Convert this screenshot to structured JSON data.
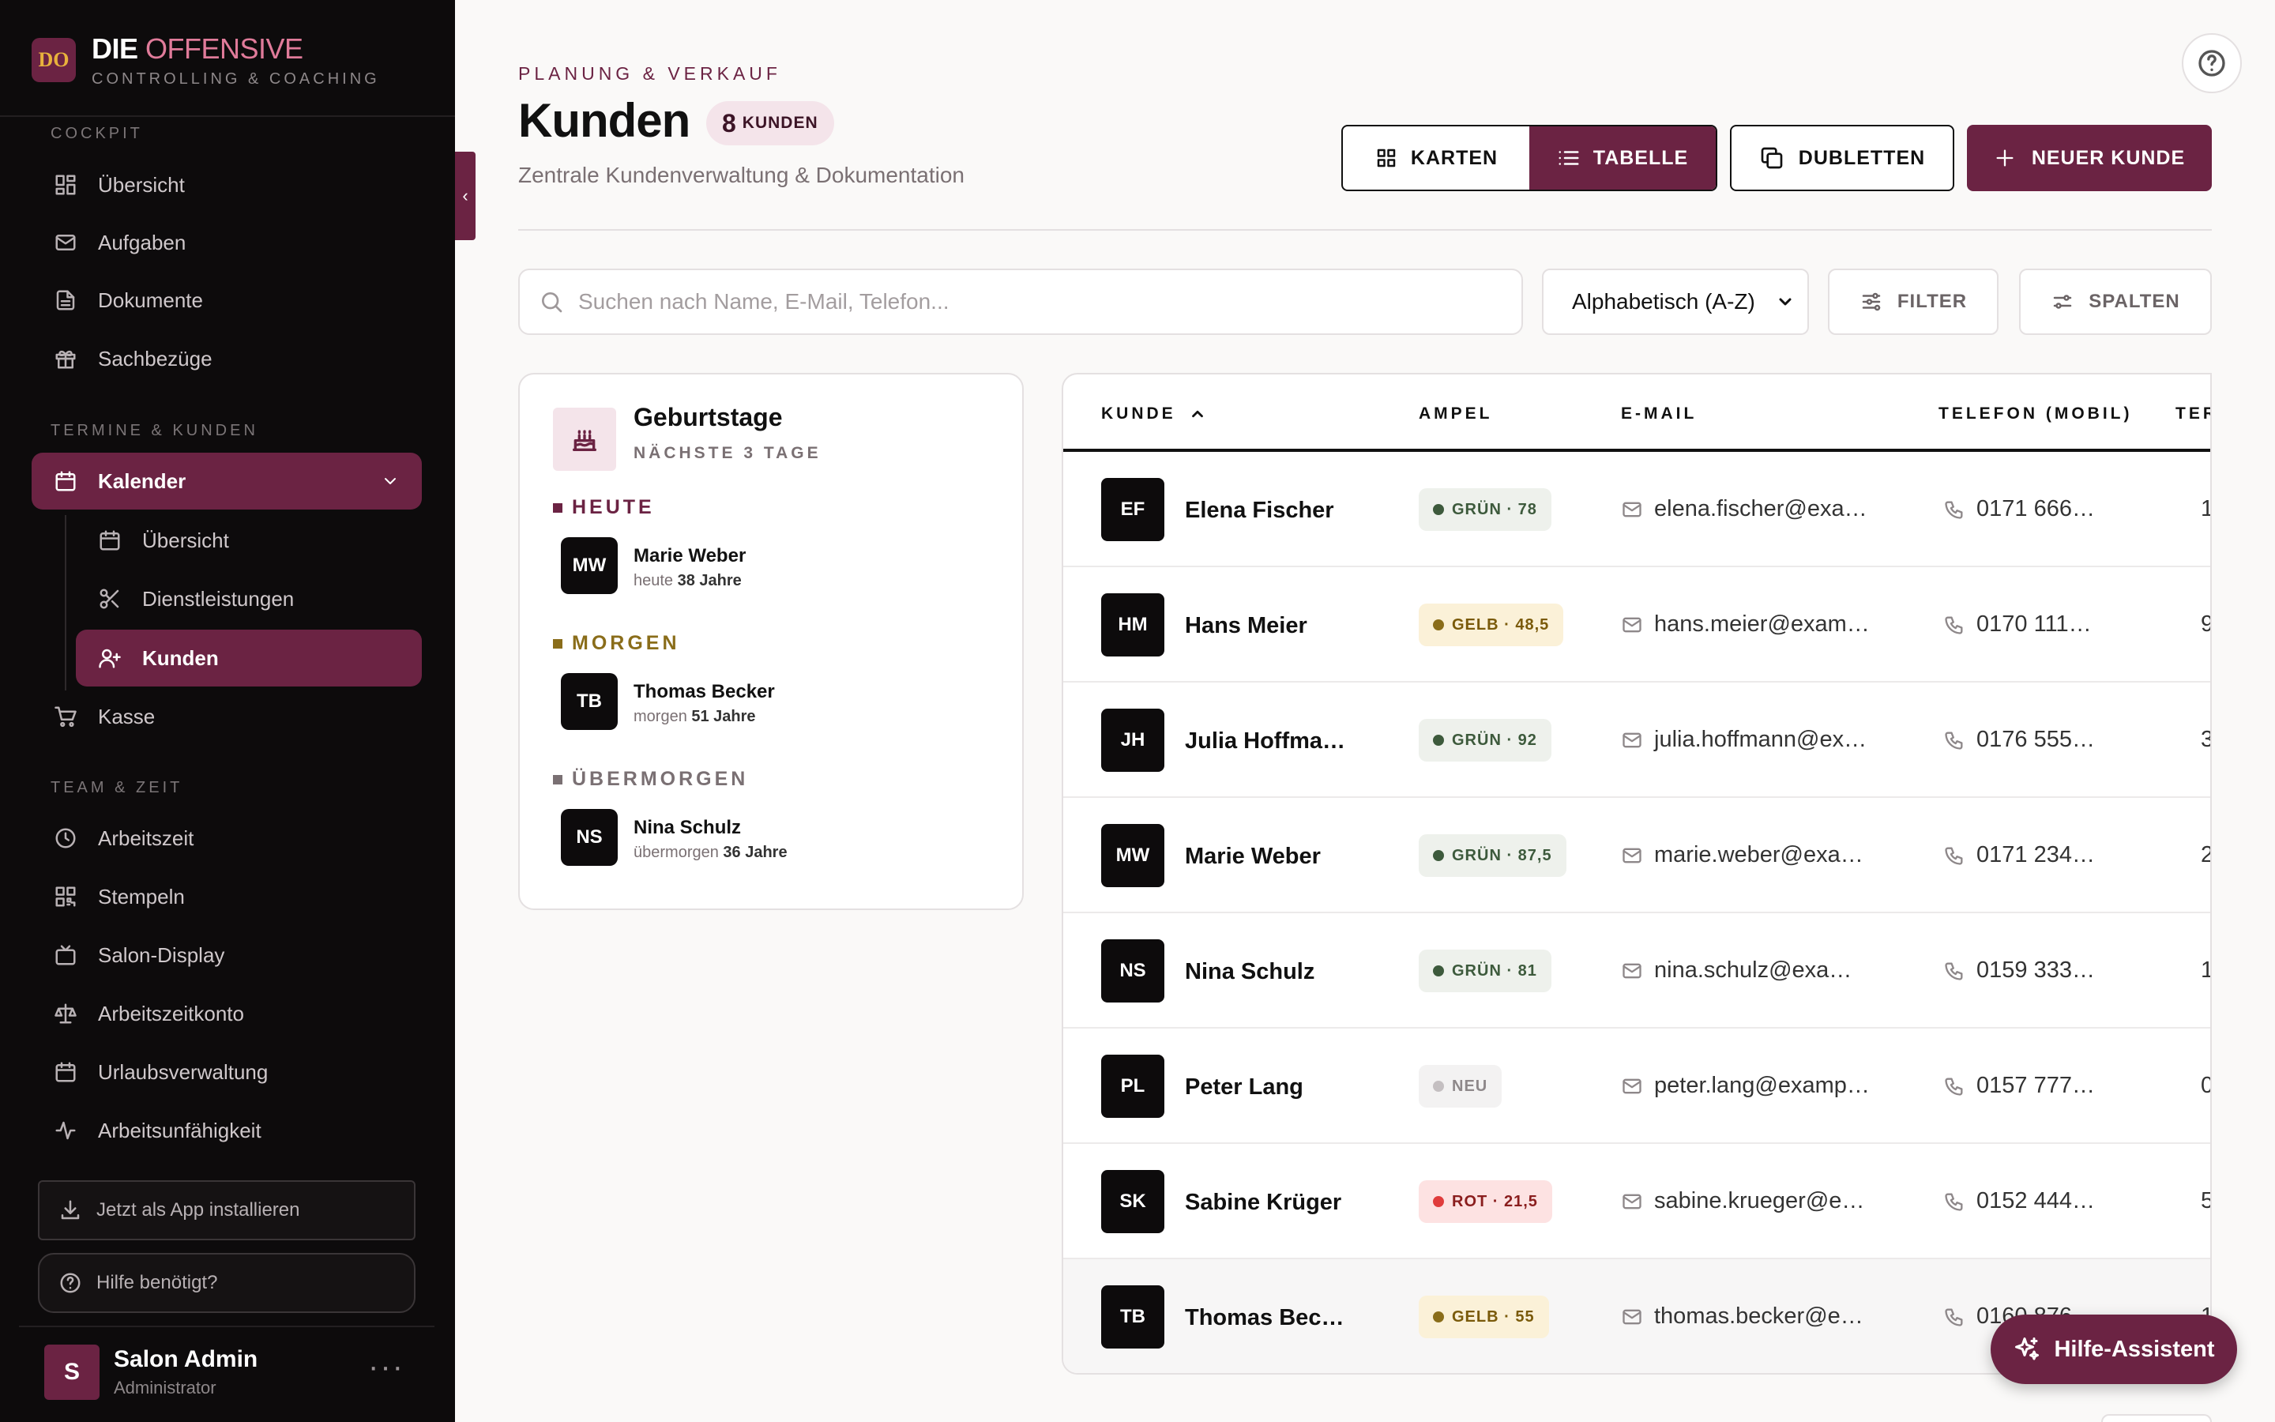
{
  "brand": {
    "logo_text": "DO",
    "name_main": "DIE",
    "name_accent": "OFFENSIVE",
    "subtitle": "CONTROLLING & COACHING",
    "accent_color": "#6b2343"
  },
  "sidebar": {
    "sections": {
      "cockpit": "COCKPIT",
      "termine": "TERMINE & KUNDEN",
      "team": "TEAM & ZEIT"
    },
    "cockpit_items": [
      {
        "label": "Übersicht",
        "icon": "dashboard-icon"
      },
      {
        "label": "Aufgaben",
        "icon": "mail-icon"
      },
      {
        "label": "Dokumente",
        "icon": "document-icon"
      },
      {
        "label": "Sachbezüge",
        "icon": "gift-icon"
      }
    ],
    "kalender": {
      "label": "Kalender",
      "icon": "calendar-icon"
    },
    "kalender_sub": [
      {
        "label": "Übersicht",
        "icon": "calendar-icon"
      },
      {
        "label": "Dienstleistungen",
        "icon": "scissors-icon"
      },
      {
        "label": "Kunden",
        "icon": "user-plus-icon"
      }
    ],
    "kasse": {
      "label": "Kasse",
      "icon": "cart-icon"
    },
    "team_items": [
      {
        "label": "Arbeitszeit",
        "icon": "clock-icon"
      },
      {
        "label": "Stempeln",
        "icon": "qr-icon"
      },
      {
        "label": "Salon-Display",
        "icon": "tv-icon"
      },
      {
        "label": "Arbeitszeitkonto",
        "icon": "scale-icon"
      },
      {
        "label": "Urlaubsverwaltung",
        "icon": "calendar-icon"
      },
      {
        "label": "Arbeitsunfähigkeit",
        "icon": "activity-icon"
      }
    ],
    "install_label": "Jetzt als App installieren",
    "help_label": "Hilfe benötigt?",
    "user": {
      "initial": "S",
      "name": "Salon Admin",
      "role": "Administrator"
    }
  },
  "header": {
    "kicker": "PLANUNG & VERKAUF",
    "title": "Kunden",
    "count": "8",
    "count_label": "KUNDEN",
    "subtitle": "Zentrale Kundenverwaltung & Dokumentation"
  },
  "toolbar": {
    "karten": "KARTEN",
    "tabelle": "TABELLE",
    "dubletten": "DUBLETTEN",
    "neuer_kunde": "NEUER KUNDE",
    "search_placeholder": "Suchen nach Name, E-Mail, Telefon...",
    "sort_value": "Alphabetisch (A-Z)",
    "filter": "FILTER",
    "spalten": "SPALTEN"
  },
  "birthdays": {
    "title": "Geburtstage",
    "subtitle": "NÄCHSTE 3 TAGE",
    "groups": [
      {
        "label": "HEUTE",
        "color": "#6b2343",
        "initials": "MW",
        "name": "Marie Weber",
        "when": "heute",
        "age": "38 Jahre"
      },
      {
        "label": "MORGEN",
        "color": "#8a6d1a",
        "initials": "TB",
        "name": "Thomas Becker",
        "when": "morgen",
        "age": "51 Jahre"
      },
      {
        "label": "ÜBERMORGEN",
        "color": "#7a7073",
        "initials": "NS",
        "name": "Nina Schulz",
        "when": "übermorgen",
        "age": "36 Jahre"
      }
    ]
  },
  "table": {
    "columns": {
      "kunde": "KUNDE",
      "ampel": "AMPEL",
      "email": "E-MAIL",
      "telefon": "TELEFON (MOBIL)",
      "termine": "TER"
    },
    "rows": [
      {
        "initials": "EF",
        "name": "Elena Fischer",
        "ampel": "GRÜN · 78",
        "status": "green",
        "email": "elena.fischer@exa…",
        "phone": "0171 666…",
        "termine": "1"
      },
      {
        "initials": "HM",
        "name": "Hans Meier",
        "ampel": "GELB · 48,5",
        "status": "yellow",
        "email": "hans.meier@exam…",
        "phone": "0170 111…",
        "termine": "9"
      },
      {
        "initials": "JH",
        "name": "Julia Hoffma…",
        "ampel": "GRÜN · 92",
        "status": "green",
        "email": "julia.hoffmann@ex…",
        "phone": "0176 555…",
        "termine": "3"
      },
      {
        "initials": "MW",
        "name": "Marie Weber",
        "ampel": "GRÜN · 87,5",
        "status": "green",
        "email": "marie.weber@exa…",
        "phone": "0171 234…",
        "termine": "2"
      },
      {
        "initials": "NS",
        "name": "Nina Schulz",
        "ampel": "GRÜN · 81",
        "status": "green",
        "email": "nina.schulz@exa…",
        "phone": "0159 333…",
        "termine": "1"
      },
      {
        "initials": "PL",
        "name": "Peter Lang",
        "ampel": "NEU",
        "status": "new",
        "email": "peter.lang@examp…",
        "phone": "0157 777…",
        "termine": "0"
      },
      {
        "initials": "SK",
        "name": "Sabine Krüger",
        "ampel": "ROT · 21,5",
        "status": "red",
        "email": "sabine.krueger@e…",
        "phone": "0152 444…",
        "termine": "5"
      },
      {
        "initials": "TB",
        "name": "Thomas Bec…",
        "ampel": "GELB · 55",
        "status": "yellow",
        "email": "thomas.becker@e…",
        "phone": "0160 876…",
        "termine": "1"
      }
    ]
  },
  "status_colors": {
    "green": {
      "bg": "#eef1ec",
      "fg": "#3d5a3c",
      "dot": "#3d5a3c"
    },
    "yellow": {
      "bg": "#fbf1d8",
      "fg": "#7a5a0a",
      "dot": "#8a6d1a"
    },
    "red": {
      "bg": "#fde2e2",
      "fg": "#8a1d1d",
      "dot": "#e03c3c"
    },
    "new": {
      "bg": "#f3f2f2",
      "fg": "#8e888a",
      "dot": "#c4bfc1"
    }
  },
  "assistant": {
    "label": "Hilfe-Assistent",
    "icon": "sparkle-icon"
  }
}
